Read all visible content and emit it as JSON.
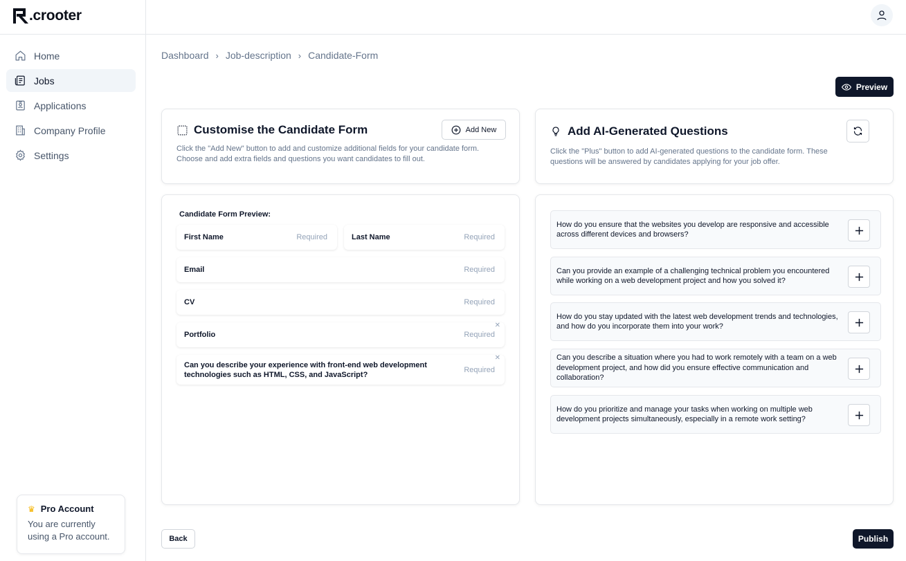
{
  "brand": {
    "name": ".crooter"
  },
  "sidebar": {
    "items": [
      {
        "label": "Home",
        "icon": "home-icon"
      },
      {
        "label": "Jobs",
        "icon": "jobs-icon",
        "active": true
      },
      {
        "label": "Applications",
        "icon": "applications-icon"
      },
      {
        "label": "Company Profile",
        "icon": "building-icon"
      },
      {
        "label": "Settings",
        "icon": "gear-icon"
      }
    ],
    "pro": {
      "title": "Pro Account",
      "text": "You are currently using a Pro account."
    }
  },
  "breadcrumb": [
    "Dashboard",
    "Job-description",
    "Candidate-Form"
  ],
  "actions": {
    "preview": "Preview",
    "back": "Back",
    "publish": "Publish"
  },
  "customise": {
    "title": "Customise the Candidate Form",
    "description": "Click the \"Add New\" button to add and customize additional fields for your candidate form. Choose and add extra fields and questions you want candidates to fill out.",
    "add_new": "Add New"
  },
  "ai": {
    "title": "Add AI-Generated Questions",
    "description": "Click the \"Plus\" button to add AI-generated questions to the candidate form. These questions will be answered by candidates applying for your job offer.",
    "questions": [
      "How do you ensure that the websites you develop are responsive and accessible across different devices and browsers?",
      "Can you provide an example of a challenging technical problem you encountered while working on a web development project and how you solved it?",
      "How do you stay updated with the latest web development trends and technologies, and how do you incorporate them into your work?",
      "Can you describe a situation where you had to work remotely with a team on a web development project, and how did you ensure effective communication and collaboration?",
      "How do you prioritize and manage your tasks when working on multiple web development projects simultaneously, especially in a remote work setting?"
    ]
  },
  "form_preview": {
    "heading": "Candidate Form Preview:",
    "required_label": "Required",
    "fields": [
      {
        "label": "First Name"
      },
      {
        "label": "Last Name"
      },
      {
        "label": "Email"
      },
      {
        "label": "CV"
      },
      {
        "label": "Portfolio",
        "removable": true
      },
      {
        "label": "Can you describe your experience with front-end web development technologies such as HTML, CSS, and JavaScript?",
        "removable": true
      }
    ]
  },
  "colors": {
    "primary": "#0f172a",
    "muted": "#64748b",
    "border": "#e5e7eb",
    "crown": "#f5b300"
  }
}
